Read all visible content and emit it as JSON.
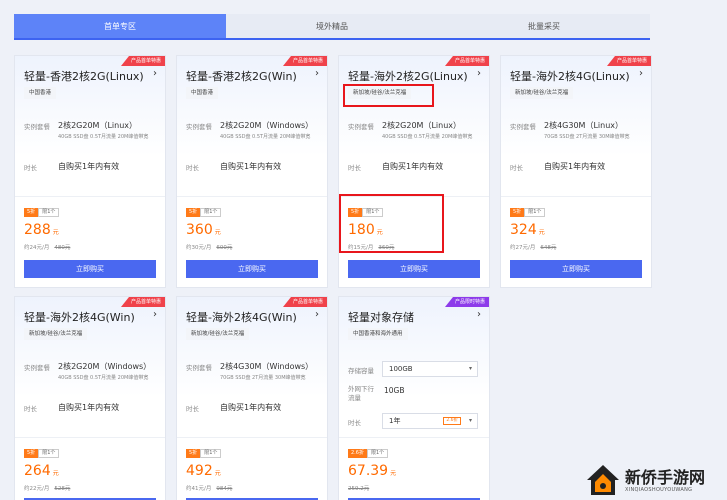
{
  "tabs": [
    {
      "label": "首单专区"
    },
    {
      "label": "境外精品"
    },
    {
      "label": "批量采买"
    }
  ],
  "cards": [
    {
      "ribbon": "产品首单特惠",
      "title": "轻量-香港2核2G(Linux)",
      "region": "中国香港",
      "spec_label": "实例套餐",
      "spec": "2核2G20M（Linux）",
      "spec_detail": "40GB SSD盘 0.5T月流量 20M峰值带宽",
      "term_label": "时长",
      "term": "自购买1年内有效",
      "disc": "5折",
      "limit": "限1个",
      "price": "288",
      "unit": "元",
      "per_month": "约24元/月",
      "orig": "480元",
      "buy": "立即购买"
    },
    {
      "ribbon": "产品首单特惠",
      "title": "轻量-香港2核2G(Win)",
      "region": "中国香港",
      "spec_label": "实例套餐",
      "spec": "2核2G20M（Windows）",
      "spec_detail": "40GB SSD盘 0.5T月流量 20M峰值带宽",
      "term_label": "时长",
      "term": "自购买1年内有效",
      "disc": "5折",
      "limit": "限1个",
      "price": "360",
      "unit": "元",
      "per_month": "约30元/月",
      "orig": "600元",
      "buy": "立即购买"
    },
    {
      "ribbon": "产品首单特惠",
      "title": "轻量-海外2核2G(Linux)",
      "region": "新加坡/硅谷/法兰克福",
      "spec_label": "实例套餐",
      "spec": "2核2G20M（Linux）",
      "spec_detail": "40GB SSD盘 0.5T月流量 20M峰值带宽",
      "term_label": "时长",
      "term": "自购买1年内有效",
      "disc": "5折",
      "limit": "限1个",
      "price": "180",
      "unit": "元",
      "per_month": "约15元/月",
      "orig": "360元",
      "buy": "立即购买"
    },
    {
      "ribbon": "产品首单特惠",
      "title": "轻量-海外2核4G(Linux)",
      "region": "新加坡/硅谷/法兰克福",
      "spec_label": "实例套餐",
      "spec": "2核4G30M（Linux）",
      "spec_detail": "70GB SSD盘 2T月流量 30M峰值带宽",
      "term_label": "时长",
      "term": "自购买1年内有效",
      "disc": "5折",
      "limit": "限1个",
      "price": "324",
      "unit": "元",
      "per_month": "约27元/月",
      "orig": "648元",
      "buy": "立即购买"
    },
    {
      "ribbon": "产品首单特惠",
      "title": "轻量-海外2核4G(Win)",
      "region": "新加坡/硅谷/法兰克福",
      "spec_label": "实例套餐",
      "spec": "2核2G20M（Windows）",
      "spec_detail": "40GB SSD盘 0.5T月流量 20M峰值带宽",
      "term_label": "时长",
      "term": "自购买1年内有效",
      "disc": "5折",
      "limit": "限1个",
      "price": "264",
      "unit": "元",
      "per_month": "约22元/月",
      "orig": "528元"
    },
    {
      "ribbon": "产品首单特惠",
      "title": "轻量-海外2核4G(Win)",
      "region": "新加坡/硅谷/法兰克福",
      "spec_label": "实例套餐",
      "spec": "2核4G30M（Windows）",
      "spec_detail": "70GB SSD盘 2T月流量 30M峰值带宽",
      "term_label": "时长",
      "term": "自购买1年内有效",
      "disc": "5折",
      "limit": "限1个",
      "price": "492",
      "unit": "元",
      "per_month": "约41元/月",
      "orig": "984元"
    }
  ],
  "storage": {
    "ribbon": "产品限时特惠",
    "title": "轻量对象存储",
    "region": "中国香港和海外通用",
    "cap_label": "存储容量",
    "cap_value": "100GB",
    "traffic_label": "外网下行流量",
    "traffic_value": "10GB",
    "term_label": "时长",
    "term_value": "1年",
    "term_disc": "2.6折",
    "disc": "2.6折",
    "limit": "限1个",
    "price": "67.39",
    "unit": "元",
    "orig": "259.2元"
  },
  "watermark": {
    "title": "新侨手游网",
    "sub": "XINQIAOSHOUYOUWANG"
  },
  "colors": {
    "accent": "#4a68f0",
    "highlight": "#e8161c",
    "price": "#ff6a00",
    "ribbon": "#f0424a"
  }
}
